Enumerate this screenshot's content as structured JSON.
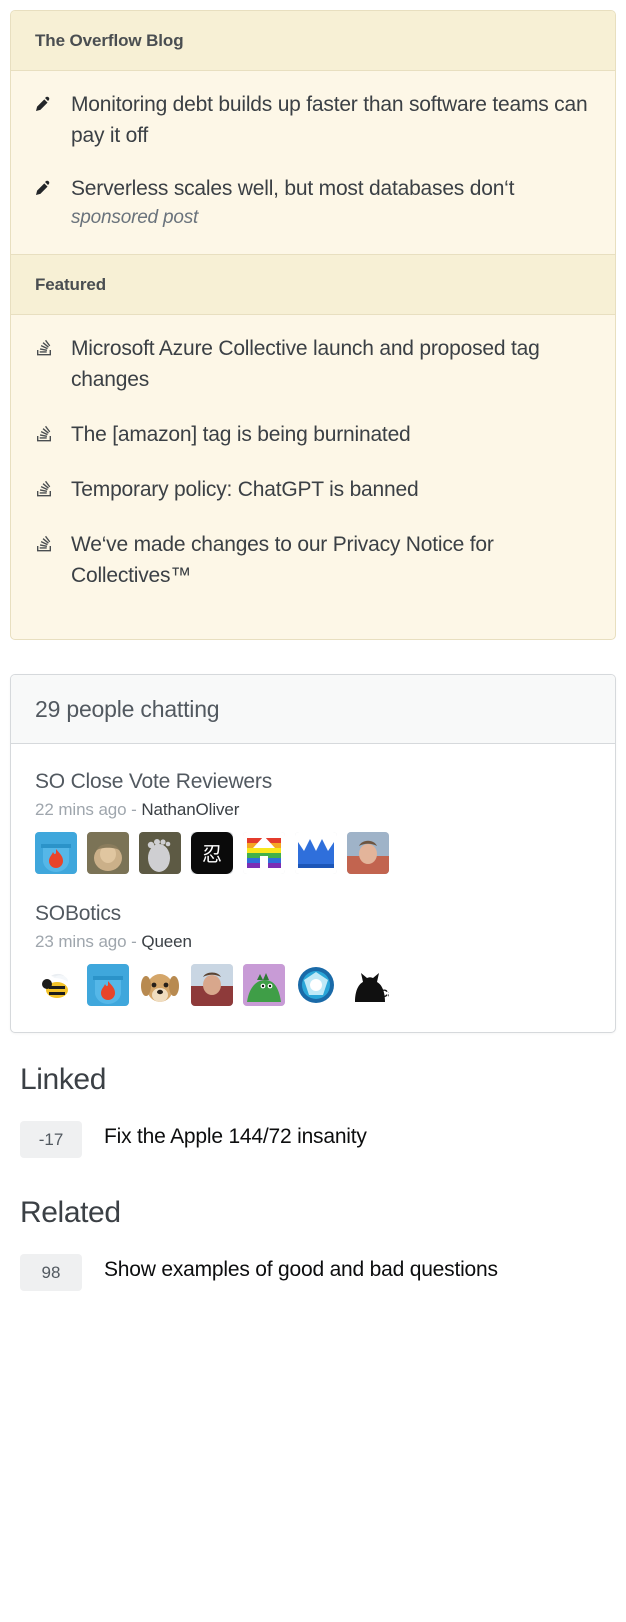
{
  "colors": {
    "panel_header_bg": "#f7f0d5",
    "panel_body_bg": "#fdf7e7",
    "panel_border": "#e8dfc0",
    "chat_header_bg": "#f8f9f9",
    "chat_border": "#d6d9dc",
    "badge_bg": "#eff0f1",
    "text_primary": "#3b4045",
    "text_muted": "#9fa6ad"
  },
  "blog": {
    "title": "The Overflow Blog",
    "items": [
      {
        "icon": "pencil-icon",
        "text": "Monitoring debt builds up faster than software teams can pay it off",
        "sub": ""
      },
      {
        "icon": "pencil-icon",
        "text": "Serverless scales well, but most databases don‘t",
        "sub": "sponsored post"
      }
    ]
  },
  "featured": {
    "title": "Featured",
    "items": [
      {
        "icon": "stacks-icon",
        "text": "Microsoft Azure Collective launch and proposed tag changes"
      },
      {
        "icon": "stacks-icon",
        "text": "The [amazon] tag is being burninated"
      },
      {
        "icon": "stacks-icon",
        "text": "Temporary policy: ChatGPT is banned"
      },
      {
        "icon": "stacks-icon",
        "text": "We‘ve made changes to our Privacy Notice for Collectives™"
      }
    ]
  },
  "chat": {
    "title": "29 people chatting",
    "rooms": [
      {
        "name": "SO Close Vote Reviewers",
        "time": "22 mins ago",
        "separator": "-",
        "user": "NathanOliver",
        "avatars": [
          {
            "name": "avatar-flame-shield",
            "kind": "flame-shield"
          },
          {
            "name": "avatar-photo-person",
            "kind": "photo-tan"
          },
          {
            "name": "avatar-foot-photo",
            "kind": "photo-foot"
          },
          {
            "name": "avatar-black-kanji",
            "kind": "kanji-black"
          },
          {
            "name": "avatar-rainbow",
            "kind": "rainbow"
          },
          {
            "name": "avatar-blue-crown",
            "kind": "blue-crown"
          },
          {
            "name": "avatar-photo-portrait",
            "kind": "photo-red"
          }
        ]
      },
      {
        "name": "SOBotics",
        "time": "23 mins ago",
        "separator": "-",
        "user": "Queen",
        "avatars": [
          {
            "name": "avatar-bee",
            "kind": "bee"
          },
          {
            "name": "avatar-flame-shield",
            "kind": "flame-shield"
          },
          {
            "name": "avatar-dog",
            "kind": "dog"
          },
          {
            "name": "avatar-photo-person",
            "kind": "photo-red"
          },
          {
            "name": "avatar-dino",
            "kind": "dino"
          },
          {
            "name": "avatar-arc-reactor",
            "kind": "arc-reactor"
          },
          {
            "name": "avatar-black-cat",
            "kind": "black-cat",
            "label": "Ca"
          }
        ]
      }
    ]
  },
  "linked": {
    "title": "Linked",
    "questions": [
      {
        "votes": "-17",
        "title": "Fix the Apple 144/72 insanity"
      }
    ]
  },
  "related": {
    "title": "Related",
    "questions": [
      {
        "votes": "98",
        "title": "Show examples of good and bad questions"
      }
    ]
  }
}
